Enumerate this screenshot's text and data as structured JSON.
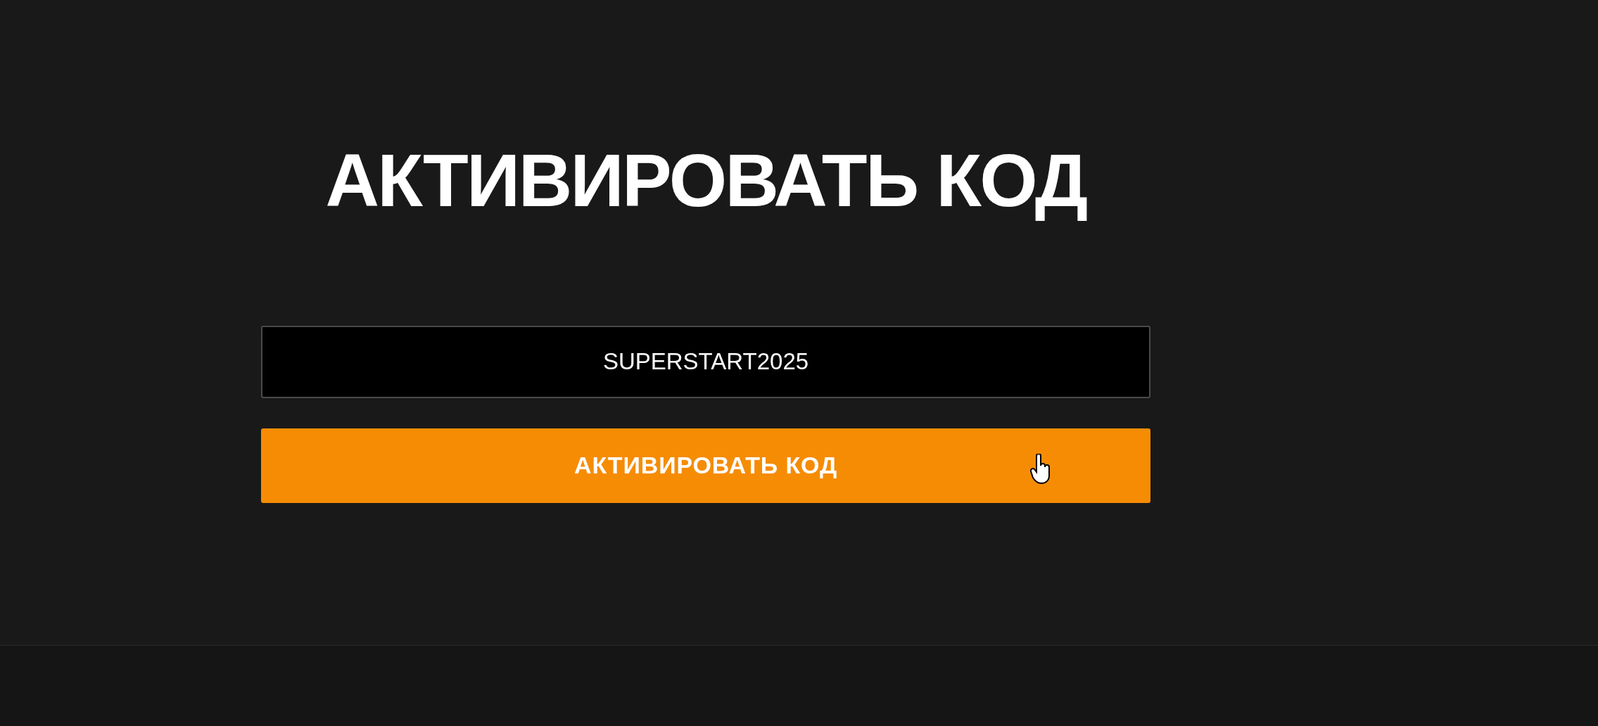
{
  "title": "АКТИВИРОВАТЬ КОД",
  "code_field": {
    "value": "SUPERSTART2025"
  },
  "activate_button": {
    "label": "АКТИВИРОВАТЬ КОД"
  }
}
